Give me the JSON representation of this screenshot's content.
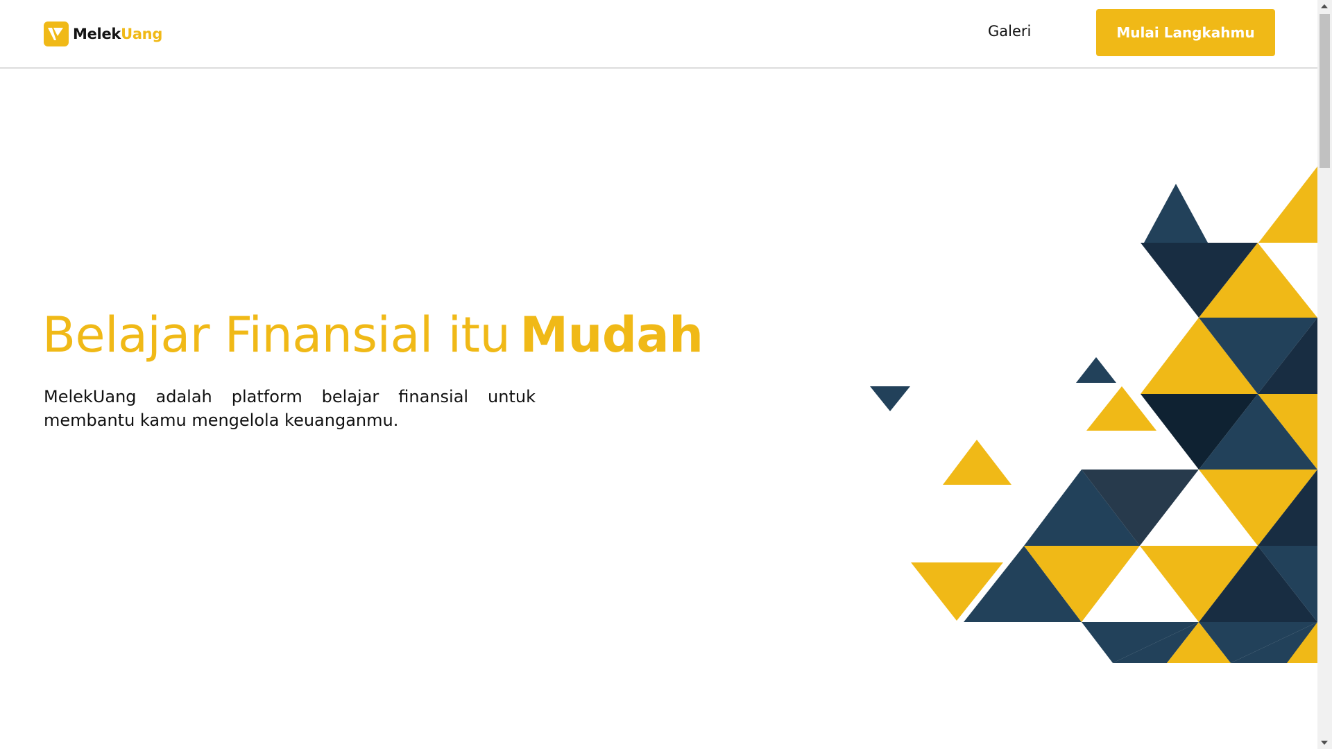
{
  "header": {
    "logo": {
      "word1": "Melek",
      "word2": "Uang",
      "icon": "melekuang-logo-icon"
    },
    "nav": {
      "galeri_label": "Galeri"
    },
    "cta_label": "Mulai Langkahmu"
  },
  "hero": {
    "title_regular": "Belajar Finansial itu",
    "title_bold": "Mudah",
    "description": "MelekUang adalah platform belajar finansial untuk membantu kamu mengelola keuanganmu."
  },
  "colors": {
    "brand_yellow": "#f0b917",
    "navy": "#22415a",
    "navy_dark": "#182d42",
    "navy_darkest": "#0f2232",
    "text": "#111111"
  }
}
